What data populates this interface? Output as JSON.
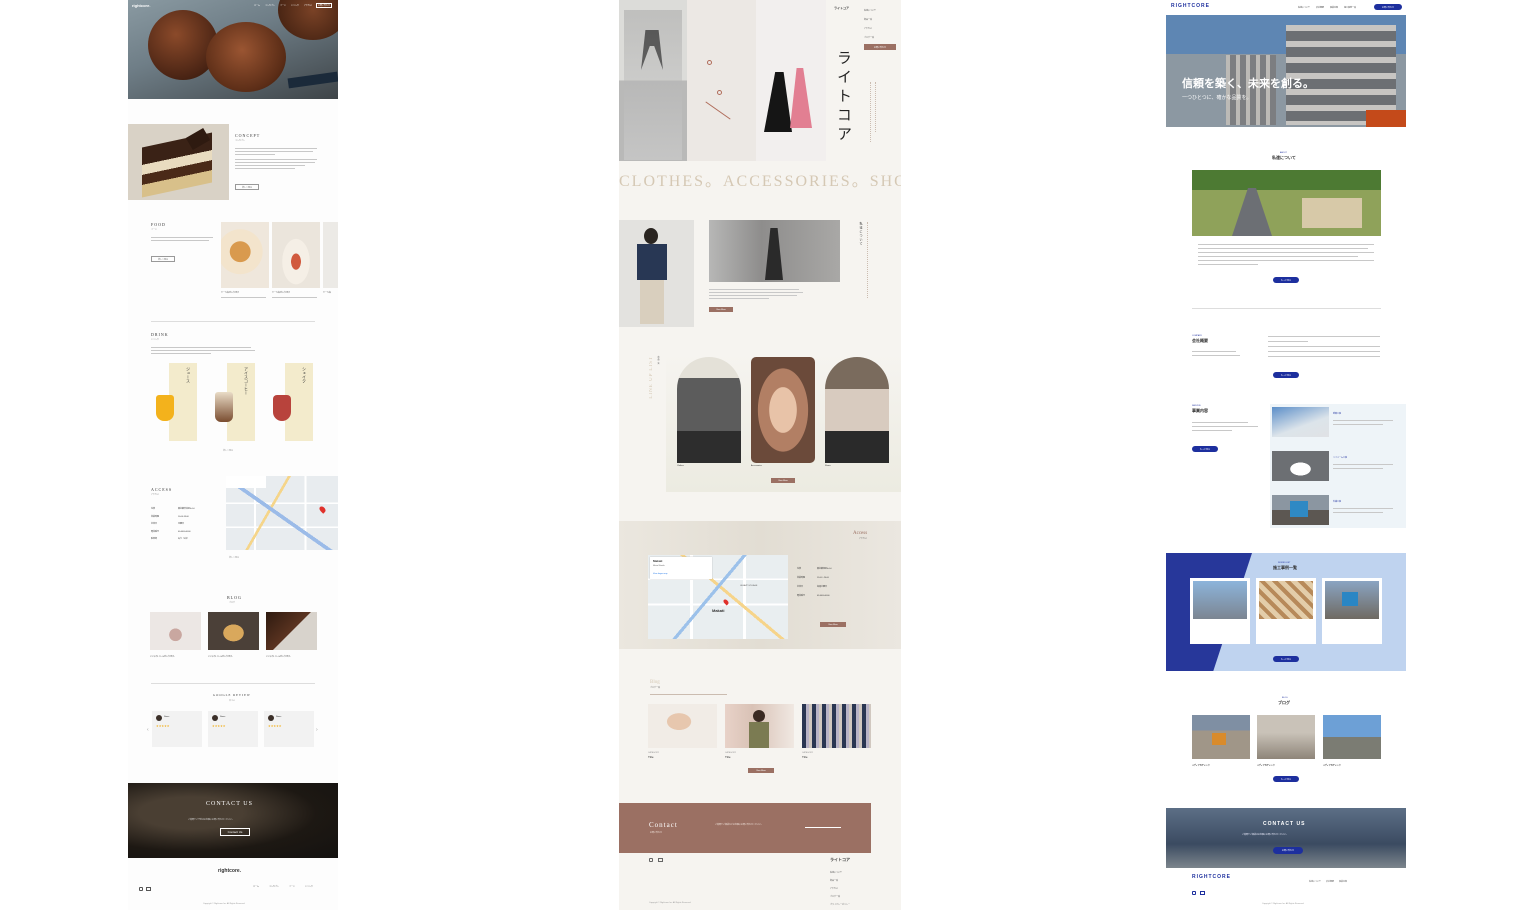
{
  "site1": {
    "logo": "rightcore.",
    "nav": [
      "ホーム",
      "コンセプト",
      "フード",
      "ドリンク",
      "アクセス",
      "ブログ"
    ],
    "nav_cta": "お問い合わせ",
    "concept": {
      "title": "CONCEPT",
      "sub": "コンセプト",
      "more": "詳しく見る"
    },
    "food": {
      "title": "FOOD",
      "sub": "フード",
      "more": "詳しく見る",
      "items": [
        "ケーキ名が入ります",
        "ケーキ名が入ります",
        "ケーキ名"
      ]
    },
    "drink": {
      "title": "DRINK",
      "sub": "ドリンク",
      "labels": [
        "ジュース",
        "アイスコーヒー",
        "シェイク"
      ],
      "more": "詳しく見る"
    },
    "access": {
      "title": "ACCESS",
      "sub": "アクセス",
      "rows": [
        [
          "住所",
          "東京都渋谷区0-0-0"
        ],
        [
          "営業時間",
          "10:00-18:00"
        ],
        [
          "定休日",
          "月曜日"
        ],
        [
          "電話番号",
          "00-0000-0000"
        ],
        [
          "駐車場",
          "あり（3台）"
        ]
      ],
      "more": "詳しく見る"
    },
    "blog": {
      "title": "BLOG",
      "sub": "ブログ",
      "posts": [
        "ここにタイトルが入ります。",
        "ここにタイトルが入ります。",
        "ここにタイトルが入ります。"
      ]
    },
    "review": {
      "title": "GOOGLE REVIEW",
      "sub": "口コミ",
      "names": [
        "Name",
        "Name",
        "Name"
      ],
      "prev": "‹",
      "next": "›"
    },
    "contact": {
      "title": "CONTACT US",
      "text": "ご質問やご予約はお気軽にお問い合わせください。",
      "button": "Contact Us"
    },
    "footer_logo": "rightcore.",
    "footer_nav": [
      "ホーム",
      "コンセプト",
      "フード",
      "ドリンク",
      "アクセス"
    ],
    "copyright": "Copyright © Rightcore Inc. All Rights Reserved."
  },
  "site2": {
    "brand_vertical": "ライトコア",
    "menu": [
      "ライトコア",
      "私達について",
      "商品一覧",
      "アクセス",
      "ブログ一覧"
    ],
    "menu_cta": "お問い合わせ",
    "marquee": "CLOTHES。ACCESSORIES。SHO",
    "about_vertical": "私達について",
    "about_more": "View More",
    "lineup_title": "LINE UP LIST",
    "lineup_sub": "商品一覧",
    "lineup_items": [
      "Clothes",
      "Accessories",
      "Shoes"
    ],
    "lineup_more": "View More",
    "access": {
      "title": "Access",
      "sub": "アクセス",
      "rows": [
        [
          "住所",
          "東京都港区0-0-0"
        ],
        [
          "営業時間",
          "11:00〜20:00"
        ],
        [
          "定休日",
          "毎週水曜日"
        ],
        [
          "電話番号",
          "03-0000-0000"
        ]
      ],
      "more": "View More"
    },
    "map_labels": {
      "place": "Makati",
      "sub": "Metro Manila",
      "link": "View larger map",
      "center": "Makati",
      "area": "LEGAZPI VILLAGE"
    },
    "blog": {
      "title": "Blog",
      "sub": "ブログ一覧",
      "items": [
        {
          "cat": "CATEGORY",
          "title": "Title"
        },
        {
          "cat": "CATEGORY",
          "title": "Title"
        },
        {
          "cat": "CATEGORY",
          "title": "Title"
        }
      ],
      "more": "View More"
    },
    "contact": {
      "title": "Contact",
      "sub": "お問い合わせ",
      "text": "ご質問やご相談などお気軽にお問い合わせください。"
    },
    "footer_brand": "ライトコア",
    "footer_nav": [
      "私達について",
      "商品一覧",
      "アクセス",
      "ブログ一覧",
      "プライバシーポリシー"
    ],
    "copyright": "Copyright © Rightcore Inc. All Rights Reserved."
  },
  "site3": {
    "logo": "RIGHTCORE",
    "nav": [
      "私達について",
      "会社概要",
      "事業内容",
      "施工事例一覧",
      "ブログ"
    ],
    "nav_cta": "お問い合わせ",
    "hero_title": "信頼を築く、未来を創る。",
    "hero_sub": "一つひとつに、確かな品質を。",
    "about": {
      "en": "ABOUT",
      "ja": "私達について",
      "more": "もっと見る"
    },
    "company": {
      "en": "COMPANY",
      "ja": "会社概要",
      "more": "もっと見る"
    },
    "service": {
      "en": "SERVICE",
      "ja": "事業内容",
      "more": "もっと見る",
      "items": [
        "新築工事",
        "リフォーム工事",
        "外構工事"
      ]
    },
    "works": {
      "en": "WORKS LIST",
      "ja": "施工事例一覧",
      "more": "もっと見る"
    },
    "blog": {
      "en": "BLOG",
      "ja": "ブログ",
      "tags": [
        "メディアのチェック",
        "メディアのチェック",
        "メディアのチェック"
      ],
      "more": "もっと見る"
    },
    "contact": {
      "title": "CONTACT US",
      "text": "ご質問やご相談はお気軽にお問い合わせください。",
      "button": "お問い合わせ"
    },
    "footer_logo": "RIGHTCORE",
    "copyright": "Copyright © Rightcore Inc. All Rights Reserved."
  },
  "colors": {
    "brown": "#9b7063",
    "cream": "#f3f0e9",
    "navy": "#1d2f9e",
    "dark": "#1f1a16"
  }
}
